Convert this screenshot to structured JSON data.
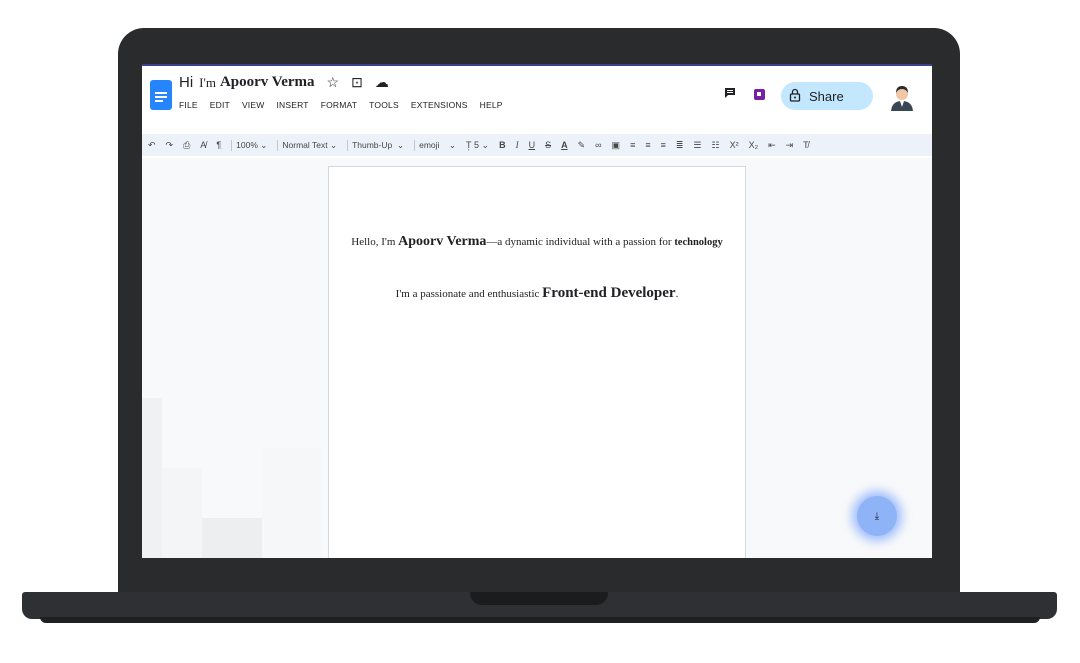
{
  "document": {
    "title_hi": "Hi",
    "title_im": "I'm",
    "title_name": "Apoorv Verma"
  },
  "menu": [
    "FILE",
    "EDIT",
    "VIEW",
    "INSERT",
    "FORMAT",
    "TOOLS",
    "EXTENSIONS",
    "HELP"
  ],
  "header": {
    "share_label": "Share"
  },
  "toolbar": {
    "zoom": "100%",
    "style": "Normal Text",
    "font": "Thumb-Up",
    "font2": "emoji",
    "font_size": "5",
    "bold": "B",
    "italic": "I",
    "underline": "U",
    "strike": "S",
    "text_color": "A",
    "superscript": "X²",
    "subscript": "X₂"
  },
  "content": {
    "p1_prefix": "Hello, I'm ",
    "p1_name": "Apoorv Verma",
    "p1_mid": "—a dynamic individual with a passion for ",
    "p1_bold": "technology",
    "p2_prefix": "I'm a passionate and enthusiastic ",
    "p2_bold": "Front-end Developer",
    "p2_suffix": "."
  },
  "colors": {
    "accent": "#2684fc",
    "share_bg": "#c2e7ff",
    "toolbar_bg": "#edf2fa",
    "meet_purple": "#7b1fa2"
  }
}
